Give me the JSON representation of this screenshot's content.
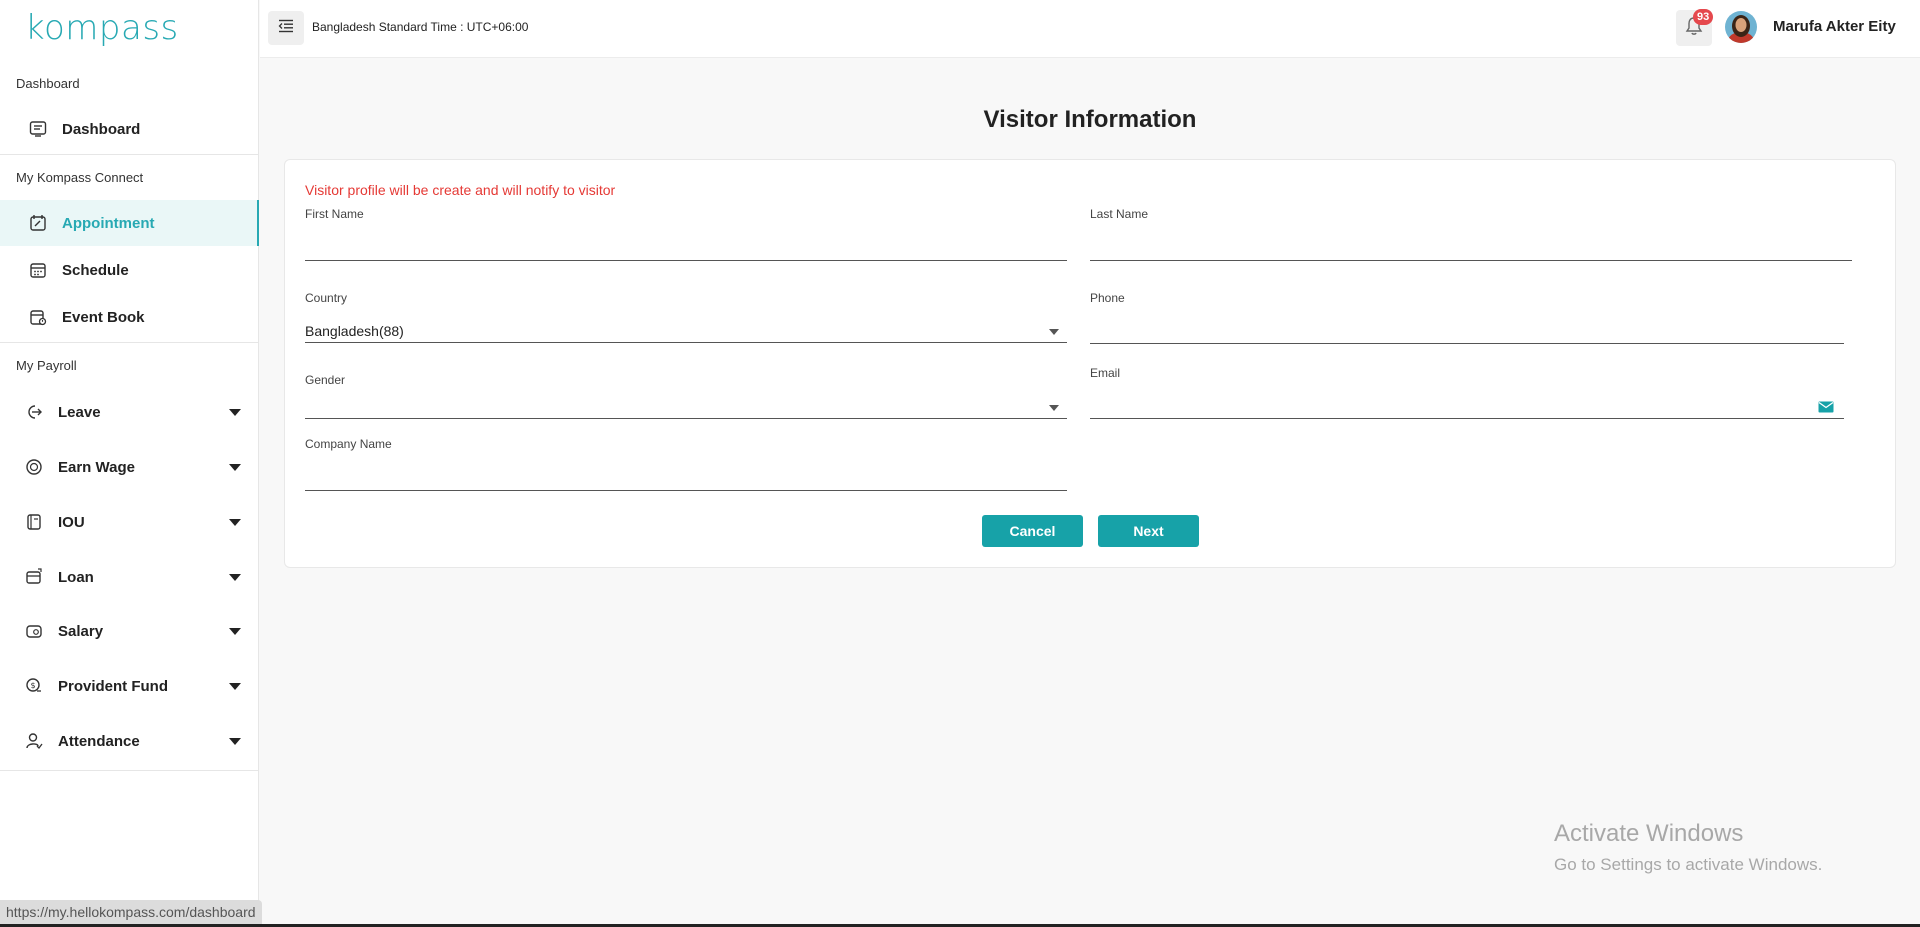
{
  "brand": {
    "logo_text": "kompass",
    "accent_color": "#27a9b3",
    "button_color": "#17a2a8",
    "notice_color": "#e53935"
  },
  "sidebar": {
    "sections": {
      "dashboard": "Dashboard",
      "connect": "My Kompass Connect",
      "payroll": "My Payroll"
    },
    "dashboard_items": [
      {
        "label": "Dashboard",
        "icon": "dashboard-icon"
      }
    ],
    "connect_items": [
      {
        "label": "Appointment",
        "icon": "appointment-icon",
        "active": true
      },
      {
        "label": "Schedule",
        "icon": "calendar-icon"
      },
      {
        "label": "Event Book",
        "icon": "event-calendar-icon"
      }
    ],
    "payroll_items": [
      {
        "label": "Leave",
        "icon": "leave-icon"
      },
      {
        "label": "Earn Wage",
        "icon": "earn-wage-icon"
      },
      {
        "label": "IOU",
        "icon": "iou-icon"
      },
      {
        "label": "Loan",
        "icon": "loan-icon"
      },
      {
        "label": "Salary",
        "icon": "salary-icon"
      },
      {
        "label": "Provident Fund",
        "icon": "provident-fund-icon"
      },
      {
        "label": "Attendance",
        "icon": "attendance-icon"
      }
    ]
  },
  "topbar": {
    "timezone": "Bangladesh Standard Time : UTC+06:00",
    "notification_count": "93",
    "user_name": "Marufa Akter Eity"
  },
  "form": {
    "title": "Visitor Information",
    "notice": "Visitor profile will be create and will notify to visitor",
    "first_name_label": "First Name",
    "first_name_value": "",
    "last_name_label": "Last Name",
    "last_name_value": "",
    "country_label": "Country",
    "country_value": "Bangladesh(88)",
    "phone_label": "Phone",
    "phone_value": "",
    "gender_label": "Gender",
    "gender_value": "",
    "email_label": "Email",
    "email_value": "",
    "company_label": "Company Name",
    "company_value": "",
    "cancel_label": "Cancel",
    "next_label": "Next"
  },
  "watermark": {
    "line1": "Activate Windows",
    "line2": "Go to Settings to activate Windows."
  },
  "status_bar_url": "https://my.hellokompass.com/dashboard"
}
